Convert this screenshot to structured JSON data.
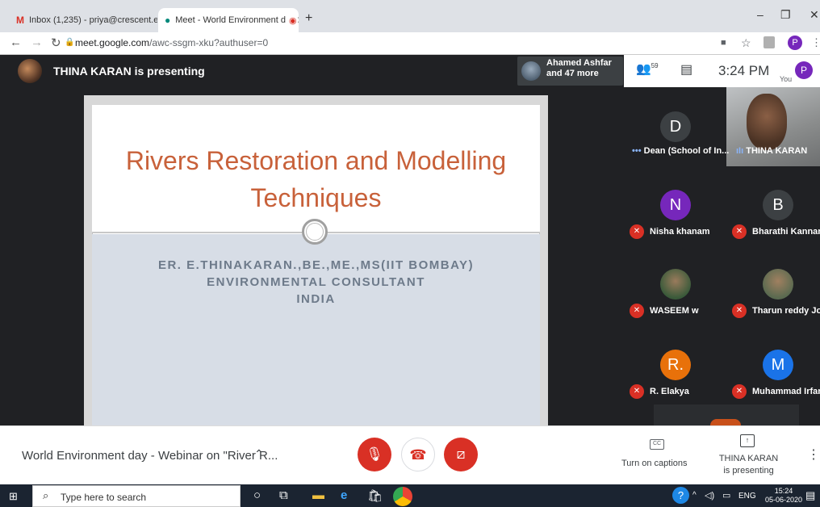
{
  "browser": {
    "tabs": [
      {
        "label": "Inbox (1,235) - priya@crescent.e",
        "icon": "gmail-icon"
      },
      {
        "label": "Meet - World Environment d",
        "icon": "meet-icon"
      }
    ],
    "url_host": "meet.google.com",
    "url_path": "/awc-ssgm-xku?authuser=0",
    "profile_initial": "P"
  },
  "meet": {
    "presenting_text": "THINA KARAN is presenting",
    "people_chip": {
      "line1": "Ahamed Ashfar",
      "line2": "and 47 more"
    },
    "participant_count": "59",
    "time": "3:24 PM",
    "you_label": "You",
    "you_initial": "P"
  },
  "slide": {
    "title_line1": "Rivers Restoration and Modelling",
    "title_line2": "Techniques",
    "sub_line1": "ER. E.THINAKARAN.,BE.,ME.,MS(IIT BOMBAY)",
    "sub_line2": "ENVIRONMENTAL CONSULTANT",
    "sub_line3": "INDIA"
  },
  "participants": [
    {
      "initial": "D",
      "name": "Dean (School of In...",
      "color": "#3c4043"
    },
    {
      "initial": "",
      "name": "THINA KARAN",
      "color": "#555"
    },
    {
      "initial": "N",
      "name": "Nisha khanam",
      "color": "#7627bb"
    },
    {
      "initial": "B",
      "name": "Bharathi Kannan",
      "color": "#3c4043"
    },
    {
      "initial": "",
      "name": "WASEEM w",
      "color": "#3a5a3a"
    },
    {
      "initial": "",
      "name": "Tharun reddy Jonn",
      "color": "#5a6a50"
    },
    {
      "initial": "R.",
      "name": "R. Elakya",
      "color": "#e8710a"
    },
    {
      "initial": "M",
      "name": "Muhammad Irfanu",
      "color": "#1a73e8"
    }
  ],
  "bottom": {
    "meeting_title": "World Environment day - Webinar on \"River R...",
    "captions_label": "Turn on captions",
    "cc_text": "CC",
    "present_line1": "THINA KARAN",
    "present_line2": "is presenting"
  },
  "taskbar": {
    "search_placeholder": "Type here to search",
    "time": "15:24",
    "date": "05-06-2020",
    "lang": "ENG"
  }
}
